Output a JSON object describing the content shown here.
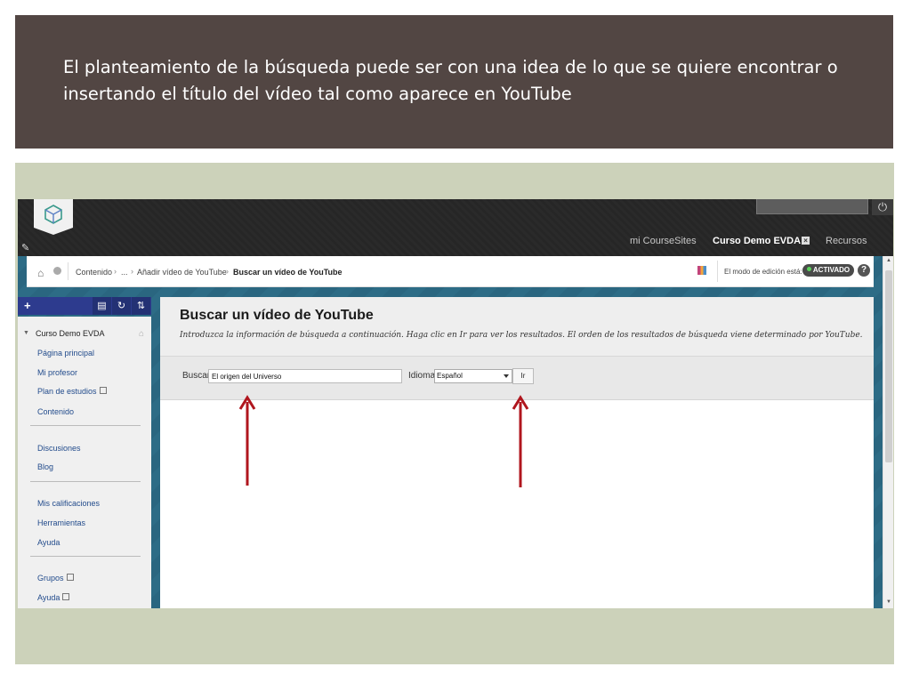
{
  "slide": {
    "title": "El planteamiento de la búsqueda puede ser con una idea de lo que se quiere encontrar o insertando el título del vídeo tal como aparece en YouTube"
  },
  "topnav": {
    "items": [
      {
        "label": "mi CourseSites"
      },
      {
        "label": "Curso Demo EVDA",
        "close": "×"
      },
      {
        "label": "Recursos"
      }
    ]
  },
  "breadcrumb": {
    "items": [
      "Contenido",
      "...",
      "Añadir vídeo de YouTube",
      "Buscar un vídeo de YouTube"
    ],
    "separator": "›"
  },
  "edit_mode": {
    "label": "El modo de edición está:",
    "state": "ACTIVADO",
    "help": "?"
  },
  "sidebar": {
    "course": "Curso Demo EVDA",
    "groups": [
      [
        "Página principal",
        "Mi profesor",
        "Plan de estudios",
        "Contenido"
      ],
      [
        "Discusiones",
        "Blog"
      ],
      [
        "Mis calificaciones",
        "Herramientas",
        "Ayuda"
      ],
      [
        "Grupos",
        "Ayuda"
      ]
    ]
  },
  "page": {
    "title": "Buscar un vídeo de YouTube",
    "instructions": "Introduzca la información de búsqueda a continuación. Haga clic en Ir para ver los resultados. El orden de los resultados de búsqueda viene determinado por YouTube."
  },
  "search": {
    "label": "Buscar",
    "value": "El origen del Universo",
    "language_label": "Idioma",
    "language_value": "Español",
    "go_label": "Ir"
  },
  "colors": {
    "banner": "#524643",
    "frame": "#ccd2ba",
    "arrow": "#b0161e",
    "sidebar_tools": "#2d3b8e",
    "toggle_dot": "#5bd35b"
  }
}
